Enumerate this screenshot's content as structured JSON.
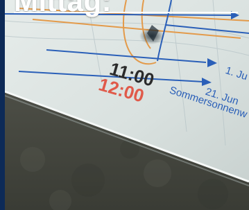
{
  "caption": {
    "title": "Mittag:"
  },
  "sign": {
    "time_black": "11:00",
    "time_red": "12:00",
    "date_label_top": "1.",
    "date_label_mid": "1. Ju",
    "date_label_bottom": "21. Jun",
    "date_sublabel": "Sommersonnenw"
  },
  "colors": {
    "border": "#0d2a57",
    "sign_blue": "#2a5fb8",
    "sign_orange": "#e39a4a",
    "sign_red": "#e05a4a",
    "time_black": "#2b2b2b"
  }
}
